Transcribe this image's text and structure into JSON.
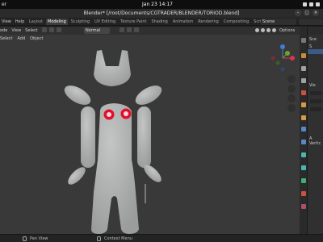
{
  "topbar": {
    "activities": "er",
    "clock": "Jan 23  14:17"
  },
  "window": {
    "title": "Blender* [/root/Documents/CGTRADER/BLENDER/TORIOD.blend]",
    "minimize": "–",
    "maximize": "□",
    "close": "✕"
  },
  "menubar": {
    "menus": [
      "View",
      "Help"
    ],
    "tabs": [
      "Layout",
      "Modeling",
      "Sculpting",
      "UV Editing",
      "Texture Paint",
      "Shading",
      "Animation",
      "Rendering",
      "Compositing",
      "Scripting"
    ],
    "active_tab": "Modeling",
    "scene": "Scene"
  },
  "viewport": {
    "header_left": [
      "ode",
      "View",
      "Select"
    ],
    "orientation": "Normal",
    "options_label": "Options",
    "sub_items": [
      "Select",
      "Add",
      "Object"
    ]
  },
  "properties": {
    "text1": "Sce",
    "text2": "S",
    "text3": "Vie",
    "text4": "A",
    "text5": "Vertic"
  },
  "statusbar": {
    "hint1": "Pan View",
    "hint2": "Context Menu"
  },
  "colors": {
    "viewport_bg": "#393939",
    "mesh_body": "#a7aaa9",
    "eye_red": "#e0102c",
    "axis_x": "#d5374d",
    "axis_y": "#6fa42f",
    "axis_z": "#3d7fd6",
    "active_tab": "#3d3d3d",
    "selection": "#3b5a85"
  },
  "icons": [
    "gear-icon",
    "shield-icon",
    "camera-icon",
    "hand-icon",
    "zoom-icon",
    "grid-icon",
    "wrench-icon",
    "particles-icon",
    "physics-icon",
    "constraint-icon",
    "data-icon",
    "material-icon",
    "texture-icon",
    "mouse-icon"
  ]
}
